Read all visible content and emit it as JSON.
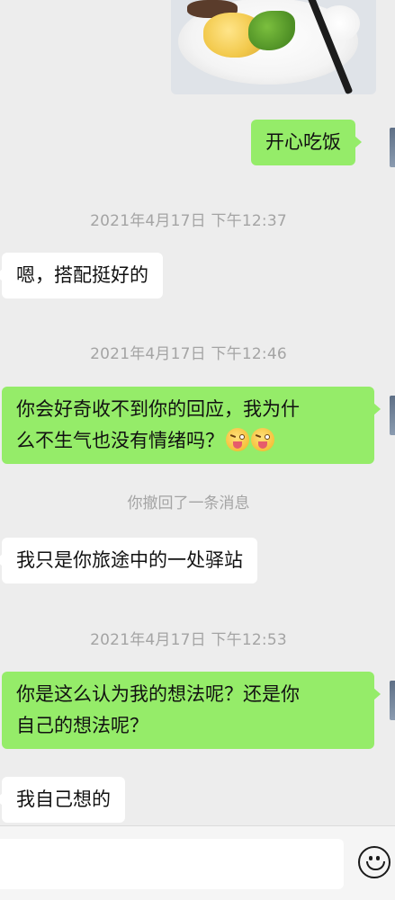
{
  "messages": {
    "m1": "开心吃饭",
    "t1": "2021年4月17日 下午12:37",
    "m2": "嗯，搭配挺好的",
    "t2": "2021年4月17日 下午12:46",
    "m3_line1": "你会好奇收不到你的回应，我为什",
    "m3_line2": "么不生气也没有情绪吗？",
    "recall": "你撤回了一条消息",
    "m4": "我只是你旅途中的一处驿站",
    "t3": "2021年4月17日 下午12:53",
    "m5_line1": "你是这么认为我的想法呢？还是你",
    "m5_line2": "自己的想法呢？",
    "m6": "我自己想的"
  },
  "icons": {
    "emoji_in_message": "squinting-face-with-tongue",
    "input_button": "smiley-face-icon"
  },
  "colors": {
    "background": "#ededed",
    "sent_bubble": "#95ec69",
    "received_bubble": "#ffffff",
    "timestamp": "#a4a4a4"
  }
}
